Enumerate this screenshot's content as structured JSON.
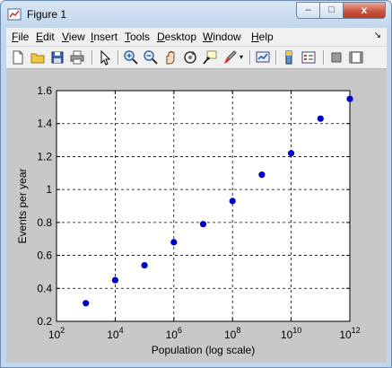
{
  "window": {
    "title": "Figure 1"
  },
  "caption_buttons": {
    "minimize": "–",
    "maximize": "□",
    "close": "x"
  },
  "menu": [
    "File",
    "Edit",
    "View",
    "Insert",
    "Tools",
    "Desktop",
    "Window",
    "Help"
  ],
  "toolbar_icons": [
    "new-figure-icon",
    "open-file-icon",
    "save-icon",
    "print-icon",
    "pointer-icon",
    "zoom-in-icon",
    "zoom-out-icon",
    "pan-icon",
    "rotate-3d-icon",
    "data-cursor-icon",
    "brush-icon",
    "link-plot-icon",
    "colorbar-icon",
    "legend-icon",
    "hide-plot-tools-icon",
    "show-plot-tools-icon"
  ],
  "colors": {
    "marker": "#0000c8",
    "figure_bg": "#c8c8c8",
    "axes_bg": "#ffffff"
  },
  "chart_data": {
    "type": "scatter",
    "title": "",
    "xlabel": "Population (log scale)",
    "ylabel": "Events per year",
    "xscale": "log",
    "xlim": [
      100,
      1000000000000
    ],
    "ylim": [
      0.2,
      1.6
    ],
    "x_ticks": [
      100,
      10000,
      1000000,
      100000000,
      10000000000,
      1000000000000
    ],
    "x_tick_labels": [
      {
        "base": "10",
        "exp": "2"
      },
      {
        "base": "10",
        "exp": "4"
      },
      {
        "base": "10",
        "exp": "6"
      },
      {
        "base": "10",
        "exp": "8"
      },
      {
        "base": "10",
        "exp": "10"
      },
      {
        "base": "10",
        "exp": "12"
      }
    ],
    "y_ticks": [
      0.2,
      0.4,
      0.6,
      0.8,
      1.0,
      1.2,
      1.4,
      1.6
    ],
    "y_tick_labels": [
      "0.2",
      "0.4",
      "0.6",
      "0.8",
      "1",
      "1.2",
      "1.4",
      "1.6"
    ],
    "grid": true,
    "x": [
      1000,
      10000,
      100000,
      1000000,
      10000000,
      100000000,
      1000000000,
      10000000000,
      100000000000,
      1000000000000
    ],
    "y": [
      0.31,
      0.45,
      0.54,
      0.68,
      0.79,
      0.93,
      1.09,
      1.22,
      1.43,
      1.55
    ]
  }
}
